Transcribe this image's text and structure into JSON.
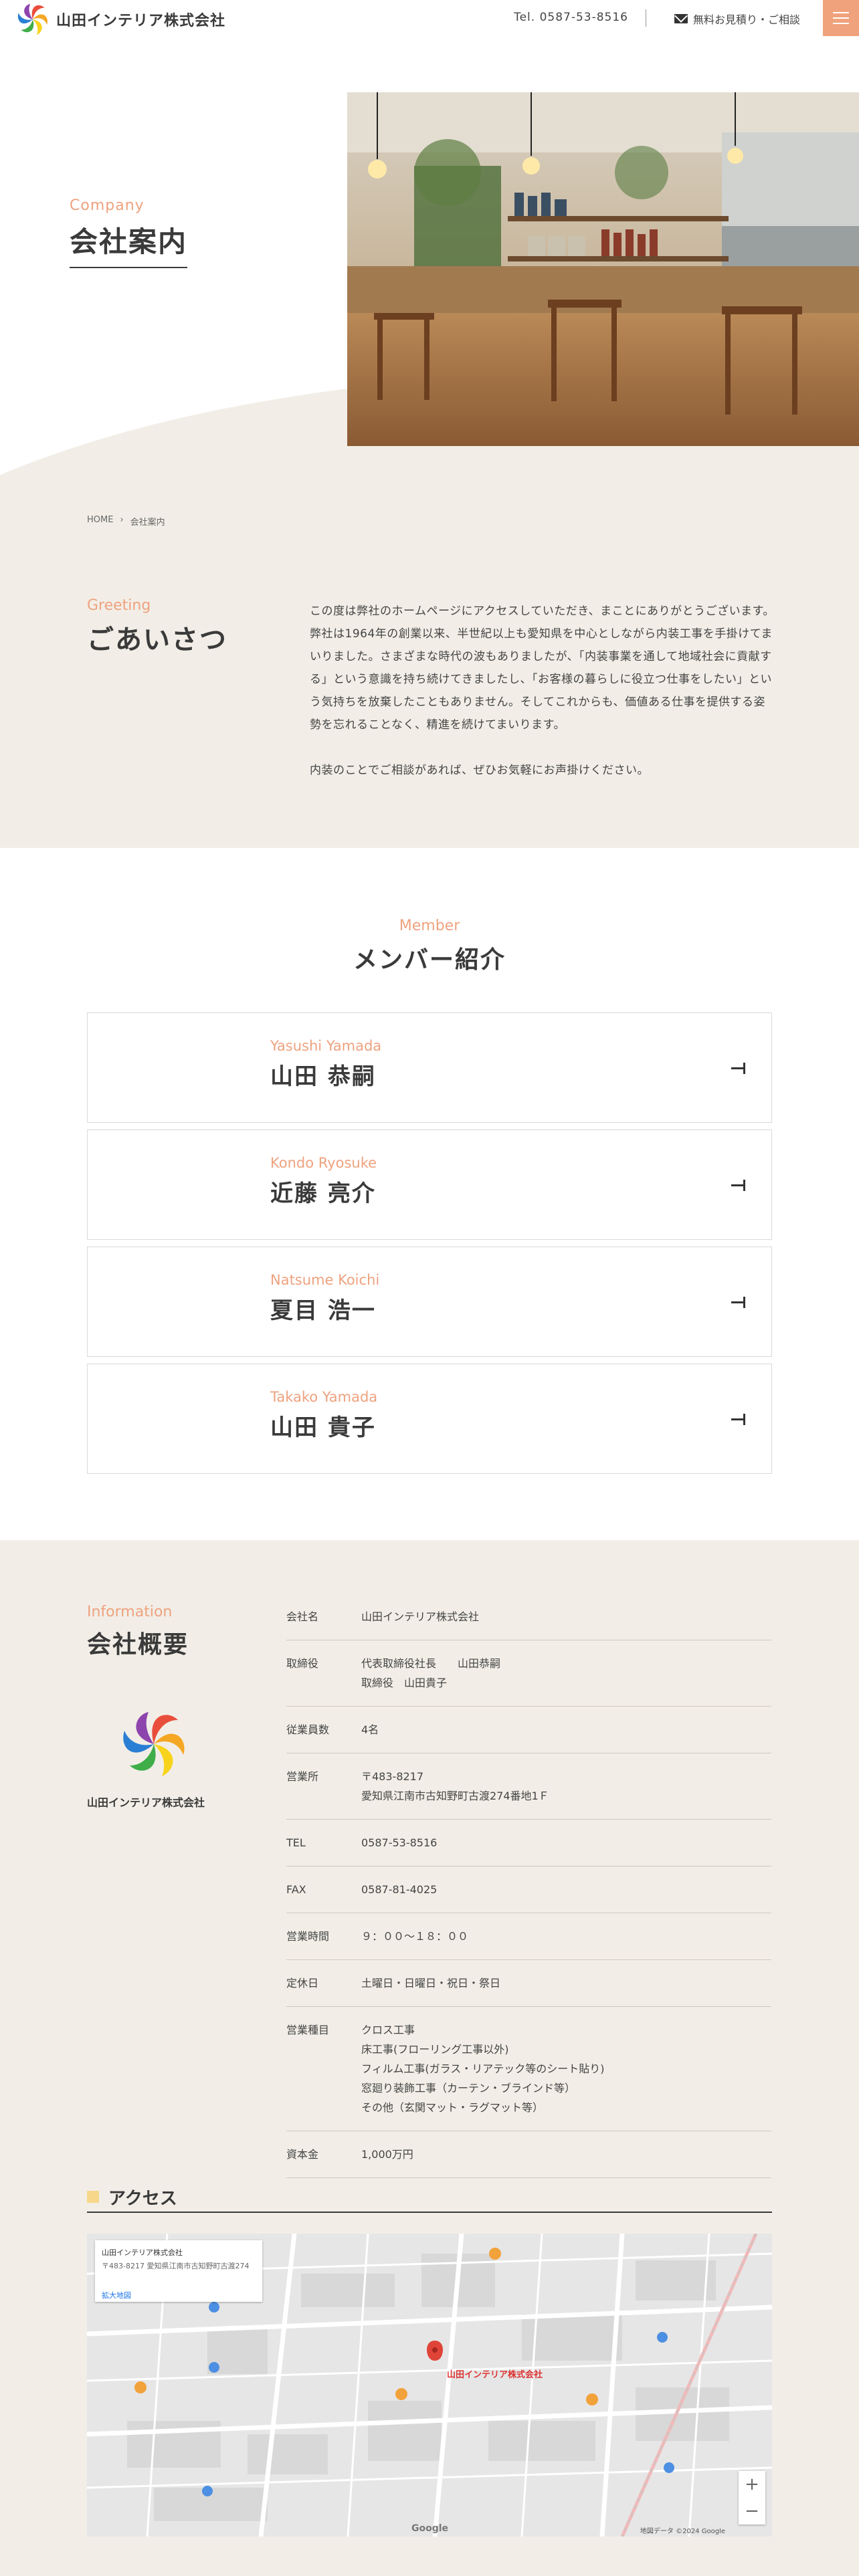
{
  "header": {
    "company_name": "山田インテリア株式会社",
    "tel": "Tel. 0587-53-8516",
    "estimate_label": "無料お見積り・ご相談",
    "menu_icon": "hamburger-icon"
  },
  "hero": {
    "label": "Company",
    "title": "会社案内"
  },
  "breadcrumb": {
    "home": "HOME",
    "separator": "›",
    "current": "会社案内"
  },
  "greeting": {
    "label": "Greeting",
    "title": "ごあいさつ",
    "paragraphs": [
      "この度は弊社のホームページにアクセスしていただき、まことにありがとうございます。弊社は1964年の創業以来、半世紀以上も愛知県を中心としながら内装工事を手掛けてまいりました。さまざまな時代の波もありましたが、「内装事業を通して地域社会に貢献する」という意識を持ち続けてきましたし、「お客様の暮らしに役立つ仕事をしたい」という気持ちを放棄したこともありません。そしてこれからも、価値ある仕事を提供する姿勢を忘れることなく、精進を続けてまいります。",
      "内装のことでご相談があれば、ぜひお気軽にお声掛けください。"
    ]
  },
  "members": {
    "label": "Member",
    "title": "メンバー紹介",
    "items": [
      {
        "en": "Yasushi Yamada",
        "ja": "山田 恭嗣"
      },
      {
        "en": "Kondo Ryosuke",
        "ja": "近藤 亮介"
      },
      {
        "en": "Natsume Koichi",
        "ja": "夏目 浩一"
      },
      {
        "en": "Takako Yamada",
        "ja": "山田 貴子"
      }
    ]
  },
  "info": {
    "label": "Information",
    "title": "会社概要",
    "logo_text": "山田インテリア株式会社",
    "rows": [
      {
        "k": "会社名",
        "v": "山田インテリア株式会社"
      },
      {
        "k": "取締役",
        "v": "代表取締役社長　　山田恭嗣\n取締役　山田貴子"
      },
      {
        "k": "従業員数",
        "v": "4名"
      },
      {
        "k": "営業所",
        "v": "〒483-8217\n愛知県江南市古知野町古渡274番地1Ｆ"
      },
      {
        "k": "TEL",
        "v": "0587-53-8516"
      },
      {
        "k": "FAX",
        "v": "0587-81-4025"
      },
      {
        "k": "営業時間",
        "v": "９：００〜１８：００"
      },
      {
        "k": "定休日",
        "v": "土曜日・日曜日・祝日・祭日"
      },
      {
        "k": "営業種目",
        "v": "クロス工事\n床工事(フローリング工事以外)\nフィルム工事(ガラス・リアテック等のシート貼り)\n窓廻り装飾工事（カーテン・ブラインド等）\nその他（玄関マット・ラグマット等）"
      },
      {
        "k": "資本金",
        "v": "1,000万円"
      }
    ]
  },
  "access": {
    "title": "アクセス",
    "map": {
      "card_title": "山田インテリア株式会社",
      "card_address": "〒483-8217 愛知県江南市古知野町古渡274",
      "card_link": "拡大地図",
      "pin_label": "山田インテリア株式会社",
      "attribution": "地図データ ©2024 Google",
      "google": "Google",
      "zoom_in": "+",
      "zoom_out": "−"
    }
  }
}
